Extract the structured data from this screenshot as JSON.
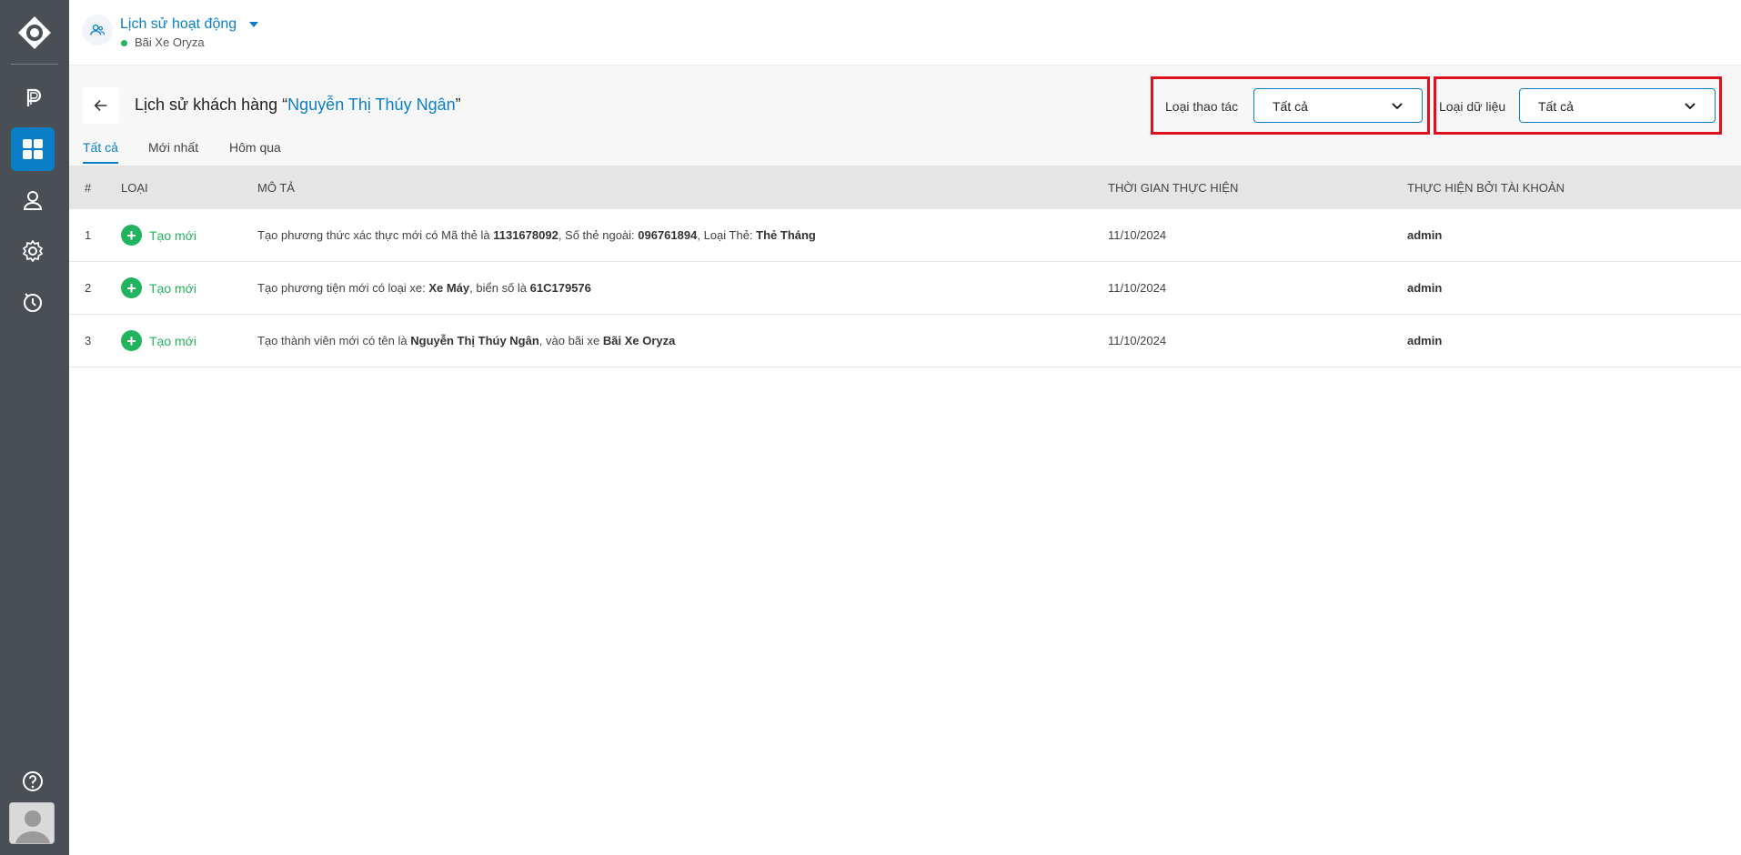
{
  "sidebar": {
    "items": [
      {
        "name": "parking",
        "icon": "parking-icon"
      },
      {
        "name": "dashboard",
        "icon": "dashboard-grid-icon",
        "active": true
      },
      {
        "name": "users",
        "icon": "user-icon"
      },
      {
        "name": "settings",
        "icon": "gear-icon"
      },
      {
        "name": "history",
        "icon": "history-icon"
      }
    ],
    "help_icon": "help-icon",
    "avatar_icon": "avatar-icon"
  },
  "header": {
    "title": "Lịch sử hoạt động",
    "subtitle": "Bãi Xe Oryza",
    "status_color": "#22b35e"
  },
  "page": {
    "title_prefix": "Lịch sử khách hàng “",
    "title_name": "Nguyễn Thị Thúy Ngân",
    "title_suffix": "”",
    "tabs": [
      {
        "label": "Tất cả",
        "active": true
      },
      {
        "label": "Mới nhất",
        "active": false
      },
      {
        "label": "Hôm qua",
        "active": false
      }
    ]
  },
  "filters": {
    "action_type": {
      "label": "Loại thao tác",
      "value": "Tất cả"
    },
    "data_type": {
      "label": "Loại dữ liệu",
      "value": "Tất cả"
    }
  },
  "table": {
    "columns": [
      "#",
      "Loại",
      "Mô tả",
      "Thời gian thực hiện",
      "Thực hiện bởi tài khoản"
    ],
    "rows": [
      {
        "num": "1",
        "type": "Tạo mới",
        "desc": [
          {
            "t": "Tạo phương thức xác thực mới có Mã thẻ là "
          },
          {
            "t": "1131678092",
            "b": true
          },
          {
            "t": ", Số thẻ ngoài: "
          },
          {
            "t": "096761894",
            "b": true
          },
          {
            "t": ", Loại Thẻ: "
          },
          {
            "t": "Thẻ Tháng",
            "b": true
          }
        ],
        "time": "11/10/2024",
        "by": "admin"
      },
      {
        "num": "2",
        "type": "Tạo mới",
        "desc": [
          {
            "t": "Tạo phương tiện mới có loại xe: "
          },
          {
            "t": "Xe Máy",
            "b": true
          },
          {
            "t": ", biển số là "
          },
          {
            "t": "61C179576",
            "b": true
          }
        ],
        "time": "11/10/2024",
        "by": "admin"
      },
      {
        "num": "3",
        "type": "Tạo mới",
        "desc": [
          {
            "t": "Tạo thành viên mới có tên là "
          },
          {
            "t": "Nguyễn Thị Thúy Ngân",
            "b": true
          },
          {
            "t": ", vào bãi xe "
          },
          {
            "t": "Bãi Xe Oryza",
            "b": true
          }
        ],
        "time": "11/10/2024",
        "by": "admin"
      }
    ]
  },
  "colors": {
    "accent": "#0a7fc7",
    "success": "#22b35e",
    "highlight_border": "#e0101a",
    "sidebar_bg": "#4a4f55"
  }
}
